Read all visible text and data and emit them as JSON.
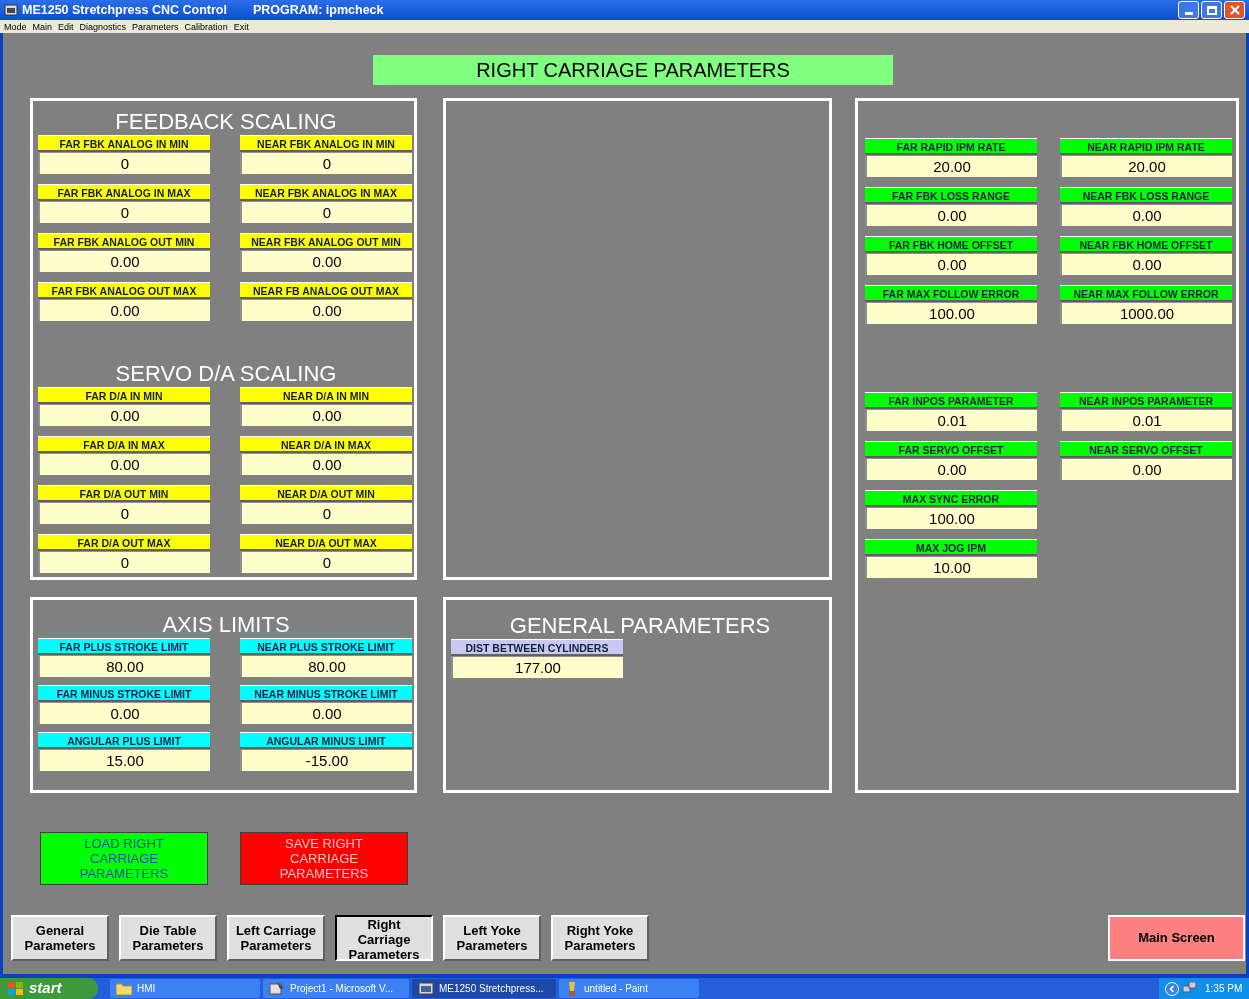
{
  "window": {
    "title": "ME1250 Stretchpress CNC Control",
    "program": "PROGRAM: ipmcheck"
  },
  "menu": [
    "Mode",
    "Main",
    "Edit",
    "Diagnostics",
    "Parameters",
    "Calibration",
    "Exit"
  ],
  "screen_title": "RIGHT CARRIAGE PARAMETERS",
  "feedback_scaling": {
    "heading": "FEEDBACK SCALING",
    "color": "#ffff00",
    "rows": [
      [
        {
          "label": "FAR FBK ANALOG IN MIN",
          "value": "0"
        },
        {
          "label": "NEAR FBK ANALOG IN MIN",
          "value": "0"
        }
      ],
      [
        {
          "label": "FAR FBK ANALOG IN MAX",
          "value": "0"
        },
        {
          "label": "NEAR FBK ANALOG IN MAX",
          "value": "0"
        }
      ],
      [
        {
          "label": "FAR FBK ANALOG OUT MIN",
          "value": "0.00"
        },
        {
          "label": "NEAR FBK ANALOG OUT MIN",
          "value": "0.00"
        }
      ],
      [
        {
          "label": "FAR FBK ANALOG OUT MAX",
          "value": "0.00"
        },
        {
          "label": "NEAR FB ANALOG OUT MAX",
          "value": "0.00"
        }
      ]
    ]
  },
  "servo_scaling": {
    "heading": "SERVO D/A SCALING",
    "color": "#ffff00",
    "rows": [
      [
        {
          "label": "FAR D/A IN MIN",
          "value": "0.00"
        },
        {
          "label": "NEAR D/A IN MIN",
          "value": "0.00"
        }
      ],
      [
        {
          "label": "FAR D/A IN MAX",
          "value": "0.00"
        },
        {
          "label": "NEAR D/A IN MAX",
          "value": "0.00"
        }
      ],
      [
        {
          "label": "FAR D/A OUT MIN",
          "value": "0"
        },
        {
          "label": "NEAR D/A OUT MIN",
          "value": "0"
        }
      ],
      [
        {
          "label": "FAR D/A OUT MAX",
          "value": "0"
        },
        {
          "label": "NEAR D/A OUT MAX",
          "value": "0"
        }
      ]
    ]
  },
  "axis_limits": {
    "heading": "AXIS LIMITS",
    "color": "#00ffff",
    "rows": [
      [
        {
          "label": "FAR PLUS STROKE LIMIT",
          "value": "80.00"
        },
        {
          "label": "NEAR PLUS STROKE LIMIT",
          "value": "80.00"
        }
      ],
      [
        {
          "label": "FAR MINUS STROKE LIMIT",
          "value": "0.00"
        },
        {
          "label": "NEAR MINUS STROKE LIMIT",
          "value": "0.00"
        }
      ],
      [
        {
          "label": "ANGULAR PLUS LIMIT",
          "value": "15.00"
        },
        {
          "label": "ANGULAR MINUS LIMIT",
          "value": "-15.00"
        }
      ]
    ]
  },
  "general_parameters": {
    "heading": "GENERAL PARAMETERS",
    "color": "#c8c8f0",
    "rows": [
      [
        {
          "label": "DIST BETWEEN CYLINDERS",
          "value": "177.00"
        }
      ]
    ]
  },
  "right_panel": {
    "color": "#00ff00",
    "groups": [
      [
        [
          {
            "label": "FAR RAPID IPM RATE",
            "value": "20.00"
          },
          {
            "label": "NEAR RAPID IPM RATE",
            "value": "20.00"
          }
        ],
        [
          {
            "label": "FAR FBK LOSS RANGE",
            "value": "0.00"
          },
          {
            "label": "NEAR FBK LOSS RANGE",
            "value": "0.00"
          }
        ],
        [
          {
            "label": "FAR FBK HOME OFFSET",
            "value": "0.00"
          },
          {
            "label": "NEAR FBK HOME OFFSET",
            "value": "0.00"
          }
        ],
        [
          {
            "label": "FAR MAX FOLLOW ERROR",
            "value": "100.00"
          },
          {
            "label": "NEAR MAX FOLLOW ERROR",
            "value": "1000.00"
          }
        ]
      ],
      [
        [
          {
            "label": "FAR INPOS PARAMETER",
            "value": "0.01"
          },
          {
            "label": "NEAR INPOS PARAMETER",
            "value": "0.01"
          }
        ],
        [
          {
            "label": "FAR SERVO OFFSET",
            "value": "0.00"
          },
          {
            "label": "NEAR SERVO OFFSET",
            "value": "0.00"
          }
        ],
        [
          {
            "label": "MAX SYNC ERROR",
            "value": "100.00"
          }
        ],
        [
          {
            "label": "MAX JOG IPM",
            "value": "10.00"
          }
        ]
      ]
    ]
  },
  "actions": [
    {
      "label": "LOAD RIGHT CARRIAGE PARAMETERS",
      "kind": "load"
    },
    {
      "label": "SAVE RIGHT CARRIAGE PARAMETERS",
      "kind": "save"
    }
  ],
  "tabs": [
    {
      "label": "General Parameters",
      "selected": false
    },
    {
      "label": "Die Table Parameters",
      "selected": false
    },
    {
      "label": "Left Carriage Parameters",
      "selected": false
    },
    {
      "label": "Right Carriage Parameters",
      "selected": true
    },
    {
      "label": "Left Yoke Parameters",
      "selected": false
    },
    {
      "label": "Right Yoke Parameters",
      "selected": false
    }
  ],
  "main_screen_button": "Main Screen",
  "taskbar": {
    "start": "start",
    "items": [
      {
        "label": "HMI",
        "kind": "folder",
        "selected": false
      },
      {
        "label": "Project1 - Microsoft V...",
        "kind": "ide",
        "selected": false
      },
      {
        "label": "ME1250 Stretchpress...",
        "kind": "app",
        "selected": true
      },
      {
        "label": "untitled - Paint",
        "kind": "paint",
        "selected": false
      }
    ],
    "clock": "1:35 PM"
  }
}
